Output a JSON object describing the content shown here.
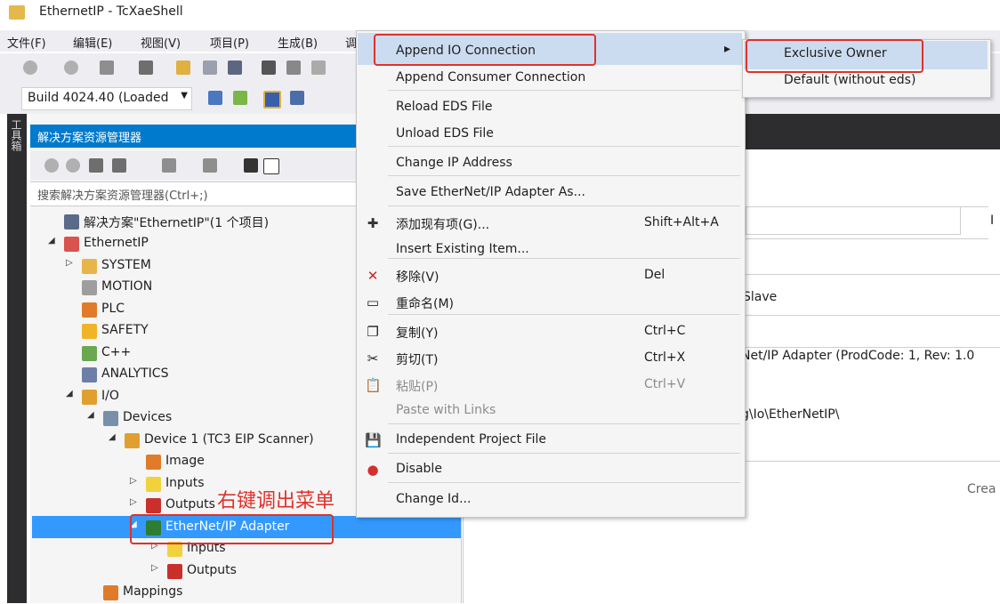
{
  "window": {
    "title": "EthernetIP - TcXaeShell"
  },
  "menu_bar": [
    "文件(F)",
    "编辑(E)",
    "视图(V)",
    "项目(P)",
    "生成(B)",
    "调"
  ],
  "toolbar": {
    "build_value": "Build 4024.40 (Loaded"
  },
  "toolbox": {
    "label": "工具箱"
  },
  "solution_explorer": {
    "title": "解决方案资源管理器",
    "search_placeholder": "搜索解决方案资源管理器(Ctrl+;)",
    "tree": [
      {
        "label": "解决方案\"EthernetIP\"(1 个项目)",
        "expander": "",
        "icon_color": "#5a6a8a",
        "icon": "solution-icon"
      },
      {
        "label": "EthernetIP",
        "expander": "◢",
        "icon_color": "#d9534f",
        "icon": "twincat-project-icon"
      },
      {
        "label": "SYSTEM",
        "expander": "▷",
        "icon_color": "#e8b54a",
        "icon": "system-icon"
      },
      {
        "label": "MOTION",
        "expander": "",
        "icon_color": "#9e9e9e",
        "icon": "motion-icon"
      },
      {
        "label": "PLC",
        "expander": "",
        "icon_color": "#e07b2a",
        "icon": "plc-icon"
      },
      {
        "label": "SAFETY",
        "expander": "",
        "icon_color": "#f0b429",
        "icon": "safety-icon"
      },
      {
        "label": "C++",
        "expander": "",
        "icon_color": "#6aa84f",
        "icon": "cpp-icon"
      },
      {
        "label": "ANALYTICS",
        "expander": "",
        "icon_color": "#6c7fa8",
        "icon": "analytics-icon"
      },
      {
        "label": "I/O",
        "expander": "◢",
        "icon_color": "#e0a030",
        "icon": "io-icon"
      },
      {
        "label": "Devices",
        "expander": "◢",
        "icon_color": "#7a8fa8",
        "icon": "devices-icon"
      },
      {
        "label": "Device 1 (TC3 EIP Scanner)",
        "expander": "◢",
        "icon_color": "#e0a030",
        "icon": "scanner-device-icon"
      },
      {
        "label": "Image",
        "expander": "",
        "icon_color": "#e07b2a",
        "icon": "image-icon"
      },
      {
        "label": "Inputs",
        "expander": "▷",
        "icon_color": "#f2d23c",
        "icon": "inputs-folder-icon"
      },
      {
        "label": "Outputs",
        "expander": "▷",
        "icon_color": "#c9302c",
        "icon": "outputs-folder-icon"
      },
      {
        "label": "EtherNet/IP Adapter",
        "expander": "◢",
        "icon_color": "#2e7d32",
        "icon": "adapter-box-icon"
      },
      {
        "label": "Inputs",
        "expander": "▷",
        "icon_color": "#f2d23c",
        "icon": "inputs-folder-icon"
      },
      {
        "label": "Outputs",
        "expander": "▷",
        "icon_color": "#c9302c",
        "icon": "outputs-folder-icon"
      },
      {
        "label": "Mappings",
        "expander": "",
        "icon_color": "#e07b2a",
        "icon": "mappings-icon"
      }
    ]
  },
  "annotation": {
    "text": "右键调出菜单"
  },
  "right_pane": {
    "slave_text": "Slave",
    "adapter_desc": "Net/IP Adapter (ProdCode: 1, Rev: 1.0",
    "path_text": "g\\Io\\EtherNetIP\\",
    "crea_text": "Crea",
    "pipe_char": "I"
  },
  "context_menu": {
    "items": [
      {
        "label": "Append IO Connection",
        "shortcut": "",
        "arrow": "▸",
        "icon": "",
        "disabled": false
      },
      {
        "label": "Append Consumer Connection",
        "shortcut": "",
        "icon": "",
        "disabled": false
      },
      {
        "label": "Reload EDS File",
        "shortcut": "",
        "icon": "",
        "disabled": false
      },
      {
        "label": "Unload EDS File",
        "shortcut": "",
        "icon": "",
        "disabled": false
      },
      {
        "label": "Change IP Address",
        "shortcut": "",
        "icon": "",
        "disabled": false
      },
      {
        "label": "Save EtherNet/IP Adapter As...",
        "shortcut": "",
        "icon": "",
        "disabled": false
      },
      {
        "label": "添加现有项(G)...",
        "shortcut": "Shift+Alt+A",
        "icon": "✚",
        "disabled": false
      },
      {
        "label": "Insert Existing Item...",
        "shortcut": "",
        "icon": "",
        "disabled": false
      },
      {
        "label": "移除(V)",
        "shortcut": "Del",
        "icon": "✕",
        "disabled": false
      },
      {
        "label": "重命名(M)",
        "shortcut": "",
        "icon": "▭",
        "disabled": false
      },
      {
        "label": "复制(Y)",
        "shortcut": "Ctrl+C",
        "icon": "❐",
        "disabled": false
      },
      {
        "label": "剪切(T)",
        "shortcut": "Ctrl+X",
        "icon": "✂",
        "disabled": false
      },
      {
        "label": "粘贴(P)",
        "shortcut": "Ctrl+V",
        "icon": "📋",
        "disabled": true
      },
      {
        "label": "Paste with Links",
        "shortcut": "",
        "icon": "",
        "disabled": true
      },
      {
        "label": "Independent Project File",
        "shortcut": "",
        "icon": "💾",
        "disabled": false
      },
      {
        "label": "Disable",
        "shortcut": "",
        "icon": "●",
        "disabled": false
      },
      {
        "label": "Change Id...",
        "shortcut": "",
        "icon": "",
        "disabled": false
      }
    ]
  },
  "submenu": {
    "items": [
      {
        "label": "Exclusive Owner"
      },
      {
        "label": "Default (without eds)"
      }
    ]
  },
  "colors": {
    "accent": "#007acc",
    "selection": "#3399ff",
    "annotation_red": "#e0312b",
    "menu_highlight": "#ccdcf0"
  }
}
